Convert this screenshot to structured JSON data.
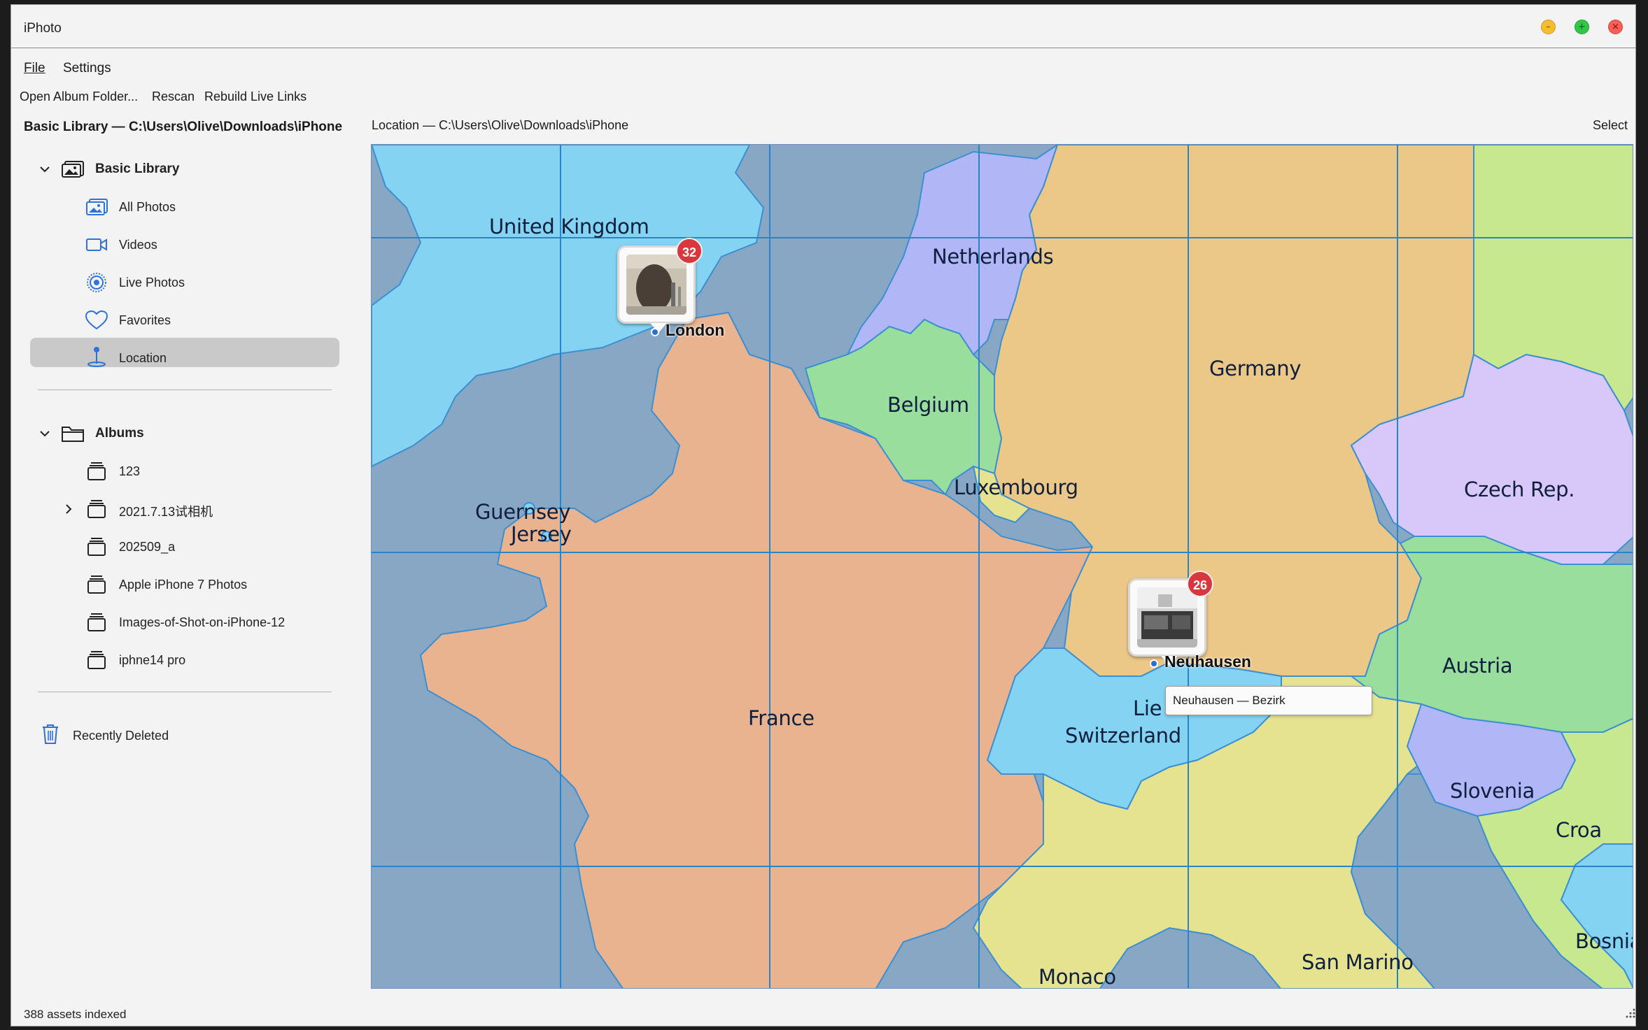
{
  "window": {
    "title": "iPhoto",
    "min_glyph": "–",
    "max_glyph": "+",
    "close_glyph": "×"
  },
  "menu": {
    "file": "File",
    "settings": "Settings"
  },
  "toolbar": {
    "open_album": "Open Album Folder...",
    "rescan": "Rescan",
    "rebuild": "Rebuild Live Links"
  },
  "sidebar": {
    "title": "Basic Library — C:\\Users\\Olive\\Downloads\\iPhone",
    "library_header": "Basic Library",
    "library_items": [
      {
        "label": "All Photos",
        "icon": "photos-icon"
      },
      {
        "label": "Videos",
        "icon": "video-icon"
      },
      {
        "label": "Live Photos",
        "icon": "live-photo-icon"
      },
      {
        "label": "Favorites",
        "icon": "heart-icon"
      },
      {
        "label": "Location",
        "icon": "location-pin-icon",
        "selected": true
      }
    ],
    "albums_header": "Albums",
    "albums": [
      {
        "label": "123"
      },
      {
        "label": "2021.7.13试相机",
        "expandable": true
      },
      {
        "label": "202509_a"
      },
      {
        "label": "Apple iPhone 7 Photos"
      },
      {
        "label": "Images-of-Shot-on-iPhone-12"
      },
      {
        "label": "iphne14 pro"
      }
    ],
    "recently_deleted": "Recently Deleted"
  },
  "main": {
    "header_label": "Location — C:\\Users\\Olive\\Downloads\\iPhone",
    "select_label": "Select"
  },
  "map": {
    "countries": [
      "United Kingdom",
      "Netherlands",
      "Germany",
      "Belgium",
      "Luxembourg",
      "Czech Rep.",
      "Guernsey",
      "Jersey",
      "France",
      "Austria",
      "Switzerland",
      "Lie",
      "Slovenia",
      "Croa",
      "Monaco",
      "San Marino",
      "Bosnia"
    ],
    "clusters": [
      {
        "name": "London",
        "count": "32"
      },
      {
        "name": "Neuhausen",
        "count": "26"
      }
    ],
    "tooltip": "Neuhausen — Bezirk",
    "colors": {
      "sea": "#87a7c5",
      "uk": "#84d3f2",
      "france": "#e9b38f",
      "germany": "#ecc888",
      "netherlands": "#b0b6f6",
      "belgium": "#9ade9e",
      "czech": "#d8c8f9",
      "austria": "#9ade9e",
      "switzerland": "#84d3f2",
      "italy": "#e6e390",
      "slovenia": "#b0b6f6",
      "grid": "#2a85c8"
    }
  },
  "status": {
    "text": "388 assets indexed"
  }
}
